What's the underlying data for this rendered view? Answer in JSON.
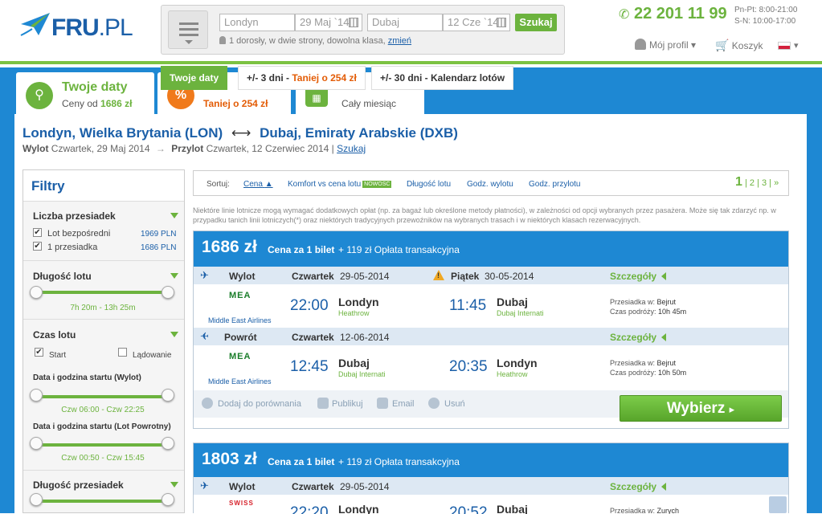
{
  "header": {
    "logo": "FRU",
    "logo_dot": ".",
    "logo_pl": "PL",
    "phone": "22 201 11 99",
    "hours_line1": "Pn-Pt: 8:00-21:00",
    "hours_line2": "S-N: 10:00-17:00",
    "profile_label": "Mój profil",
    "cart_label": "Koszyk"
  },
  "search": {
    "origin": "Londyn",
    "depart_date": "29 Maj `14",
    "destination": "Dubaj",
    "return_date": "12 Cze `14",
    "search_button": "Szukaj",
    "pax_text": "1 dorosły, w dwie strony, dowolna klasa,",
    "change_link": "zmień"
  },
  "tabs": [
    {
      "title": "Twoje daty",
      "sub_prefix": "Ceny od",
      "sub_value": "1686 zł"
    },
    {
      "sub_value": "Taniej o 254 zł"
    },
    {
      "sub": "Cały miesiąc"
    }
  ],
  "tooltip": {
    "t1": "Twoje daty",
    "t2_prefix": "+/- 3 dni - ",
    "t2_value": "Taniej o 254 zł",
    "t3": "+/- 30 dni - Kalendarz lotów"
  },
  "route": {
    "from": "Londyn, Wielka Brytania (LON)",
    "arrow": "⟷",
    "to": "Dubaj, Emiraty Arabskie (DXB)",
    "depart_label": "Wylot",
    "depart_date": "Czwartek, 29 Maj 2014",
    "arrive_label": "Przylot",
    "arrive_date": "Czwartek, 12 Czerwiec 2014",
    "search_link": "Szukaj"
  },
  "filters": {
    "title": "Filtry",
    "stops_title": "Liczba przesiadek",
    "stop1_label": "Lot bezpośredni",
    "stop1_price": "1969 PLN",
    "stop2_label": "1 przesiadka",
    "stop2_price": "1686 PLN",
    "duration_title": "Długość lotu",
    "duration_value": "7h 20m - 13h 25m",
    "time_title": "Czas lotu",
    "start_label": "Start",
    "landing_label": "Lądowanie",
    "dep_title": "Data i godzina startu (Wylot)",
    "dep_value": "Czw 06:00 - Czw 22:25",
    "ret_title": "Data i godzina startu (Lot Powrotny)",
    "ret_value": "Czw 00:50 - Czw 15:45",
    "layover_title": "Długość przesiadek"
  },
  "sort": {
    "label": "Sortuj:",
    "price": "Cena",
    "comfort": "Komfort vs cena lotu",
    "new_badge": "NOWOŚĆ",
    "duration": "Długość lotu",
    "dep_time": "Godz. wylotu",
    "arr_time": "Godz. przylotu",
    "page_current": "1",
    "page2": "2",
    "page3": "3",
    "page_next": "»"
  },
  "notice": "Niektóre linie lotnicze mogą wymagać dodatkowych opłat (np. za bagaż lub określone metody płatności), w zależności od opcji wybranych przez pasażera. Może się tak zdarzyć np. w przypadku tanich linii lotniczych(*) oraz niektórych tradycyjnych przewoźników na wybranych trasach i w niektórych klasach rezerwacyjnych.",
  "results": [
    {
      "price": "1686 zł",
      "price_label": "Cena za 1 bilet",
      "fee": "+ 119 zł Opłata transakcyjna",
      "outbound": {
        "direction": "Wylot",
        "day": "Czwartek",
        "date": "29-05-2014",
        "day2": "Piątek",
        "date2": "30-05-2014",
        "details": "Szczegóły",
        "airline_logo": "MEA",
        "airline": "Middle East Airlines",
        "dep_time": "22:00",
        "dep_city": "Londyn",
        "dep_airport": "Heathrow",
        "arr_time": "11:45",
        "arr_city": "Dubaj",
        "arr_airport": "Dubaj Internati",
        "layover_label": "Przesiadka w:",
        "layover_city": "Bejrut",
        "duration_label": "Czas podróży:",
        "duration": "10h 45m"
      },
      "inbound": {
        "direction": "Powrót",
        "day": "Czwartek",
        "date": "12-06-2014",
        "details": "Szczegóły",
        "airline_logo": "MEA",
        "airline": "Middle East Airlines",
        "dep_time": "12:45",
        "dep_city": "Dubaj",
        "dep_airport": "Dubaj Internati",
        "arr_time": "20:35",
        "arr_city": "Londyn",
        "arr_airport": "Heathrow",
        "layover_label": "Przesiadka w:",
        "layover_city": "Bejrut",
        "duration_label": "Czas podróży:",
        "duration": "10h 50m"
      },
      "footer": {
        "compare": "Dodaj do porównania",
        "publish": "Publikuj",
        "email": "Email",
        "delete": "Usuń",
        "select": "Wybierz"
      }
    },
    {
      "price": "1803 zł",
      "price_label": "Cena za 1 bilet",
      "fee": "+ 119 zł Opłata transakcyjna",
      "outbound": {
        "direction": "Wylot",
        "day": "Czwartek",
        "date": "29-05-2014",
        "details": "Szczegóły",
        "airline_logo": "SWISS",
        "dep_time": "22:20",
        "dep_city": "Londyn",
        "arr_time": "20:52",
        "arr_city": "Dubaj",
        "layover_label": "Przesiadka w:",
        "layover_city": "Zurych"
      }
    }
  ]
}
